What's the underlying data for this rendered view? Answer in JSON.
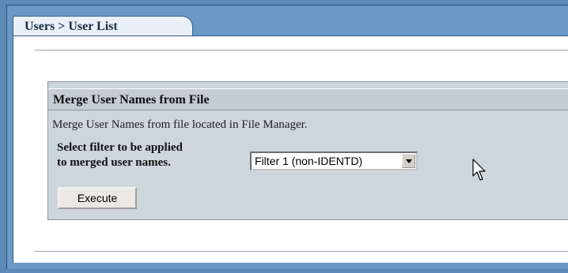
{
  "breadcrumb": "Users > User List",
  "section": {
    "title": "Merge User Names from File",
    "description": "Merge User Names from file located in File Manager.",
    "filter_label_line1": "Select filter to be applied",
    "filter_label_line2": "to merged user names.",
    "filter_select": {
      "selected": "Filter 1 (non-IDENTD)"
    },
    "execute_label": "Execute"
  },
  "icons": {
    "dropdown": "chevron-down-icon",
    "pointer": "mouse-pointer-icon"
  },
  "colors": {
    "page_background": "#6b98c4",
    "tab_background": "#e9f0fa",
    "box_background": "#cdd5dd"
  }
}
